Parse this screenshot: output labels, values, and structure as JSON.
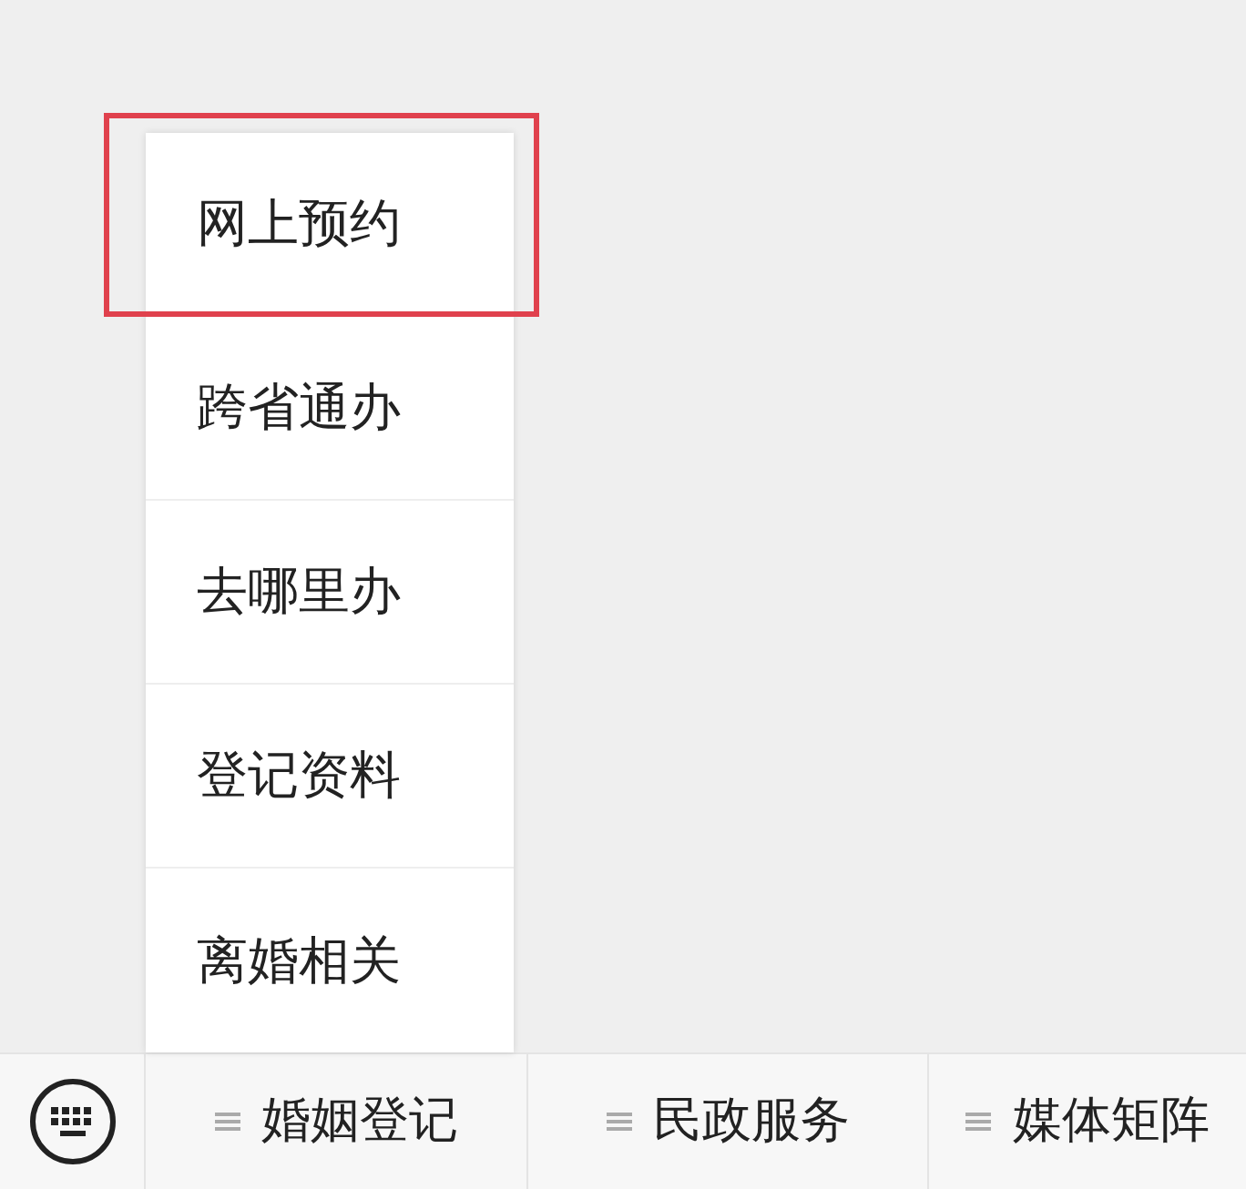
{
  "submenu": {
    "items": [
      {
        "label": "网上预约",
        "highlighted": true
      },
      {
        "label": "跨省通办",
        "highlighted": false
      },
      {
        "label": "去哪里办",
        "highlighted": false
      },
      {
        "label": "登记资料",
        "highlighted": false
      },
      {
        "label": "离婚相关",
        "highlighted": false
      }
    ]
  },
  "menu_bar": {
    "items": [
      {
        "label": "婚姻登记"
      },
      {
        "label": "民政服务"
      },
      {
        "label": "媒体矩阵"
      }
    ]
  }
}
